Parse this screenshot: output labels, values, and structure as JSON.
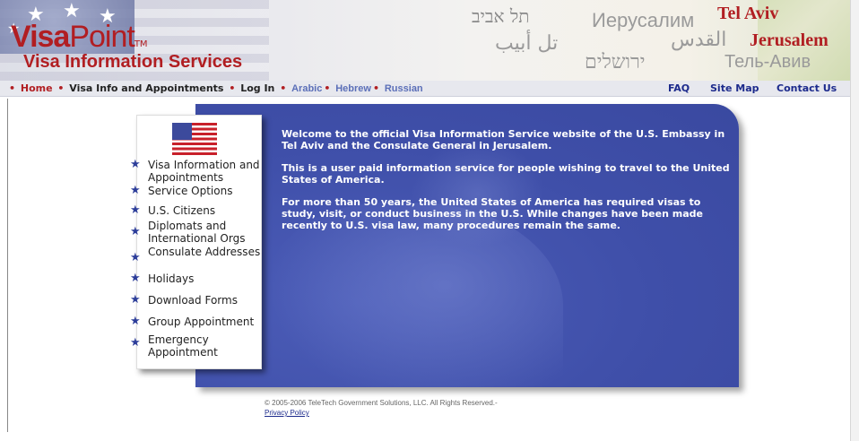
{
  "header": {
    "logo_visa": "Visa",
    "logo_point": "Point",
    "logo_tm": "TM",
    "logo_subtitle": "Visa Information Services",
    "cities": {
      "hebrew_tel_aviv": "תל אביב",
      "russian_jerusalem": "Иерусалим",
      "english_tel_aviv": "Tel Aviv",
      "arabic_tel_aviv": "تل أبيب",
      "arabic_jerusalem": "القدس",
      "english_jerusalem": "Jerusalem",
      "hebrew_jerusalem": "ירושלים",
      "russian_tel_aviv": "Тель-Авив"
    }
  },
  "nav": {
    "home": "Home",
    "visa_info": "Visa Info and Appointments",
    "log_in": "Log In",
    "arabic": "Arabic",
    "hebrew": "Hebrew",
    "russian": "Russian",
    "faq": "FAQ",
    "site_map": "Site Map",
    "contact_us": "Contact Us"
  },
  "menu": {
    "items": [
      {
        "label": "Visa Information and Appointments"
      },
      {
        "label": "Service Options"
      },
      {
        "label": "U.S. Citizens"
      },
      {
        "label": "Diplomats and International Orgs"
      },
      {
        "label": "Consulate Addresses"
      },
      {
        "label": "Holidays"
      },
      {
        "label": "Download Forms"
      },
      {
        "label": "Group Appointment"
      },
      {
        "label": "Emergency Appointment"
      }
    ]
  },
  "main": {
    "para1": "Welcome to the official Visa Information Service website of the U.S. Embassy in Tel Aviv and the Consulate General in Jerusalem.",
    "para2": "This is a user paid information service for people wishing to travel to the United States of America.",
    "para3": "For more than 50 years, the United States of America has required visas to study, visit, or conduct business in the U.S. While changes have been made recently to U.S. visa law, many procedures remain the same."
  },
  "footer": {
    "copyright": "© 2005-2006 TeleTech Government Solutions, LLC. All Rights Reserved.-",
    "privacy": "Privacy Policy"
  },
  "colors": {
    "brand_red": "#b11e22",
    "panel_blue": "#3f4fa9",
    "link_blue": "#1c2a8c"
  }
}
